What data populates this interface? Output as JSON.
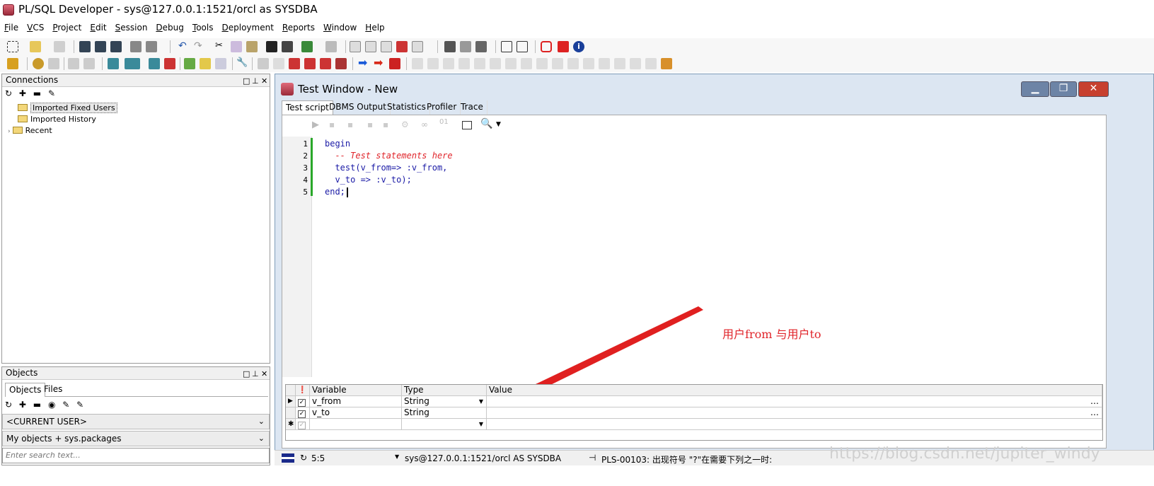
{
  "window": {
    "title": "PL/SQL Developer - sys@127.0.0.1:1521/orcl as SYSDBA"
  },
  "menu": [
    "File",
    "VCS",
    "Project",
    "Edit",
    "Session",
    "Debug",
    "Tools",
    "Deployment",
    "Reports",
    "Window",
    "Help"
  ],
  "connections": {
    "title": "Connections",
    "items": [
      "Imported Fixed Users",
      "Imported History",
      "Recent"
    ]
  },
  "objects": {
    "title": "Objects",
    "tabs": [
      "Objects",
      "Files"
    ],
    "user_select": "<CURRENT USER>",
    "filter_select": "My objects + sys.packages",
    "search_placeholder": "Enter search text..."
  },
  "test_window": {
    "title": "Test Window - New",
    "tabs": [
      "Test script",
      "DBMS Output",
      "Statistics",
      "Profiler",
      "Trace"
    ],
    "code_lines": [
      {
        "num": "1",
        "text": "begin",
        "style": "kw"
      },
      {
        "num": "2",
        "text": "  -- Test statements here",
        "style": "comment"
      },
      {
        "num": "3",
        "text": "  test(v_from=> :v_from,",
        "style": "kw"
      },
      {
        "num": "4",
        "text": "  v_to => :v_to);",
        "style": "kw"
      },
      {
        "num": "5",
        "text": "end;",
        "style": "kw"
      }
    ],
    "annotation": "用户from 与用户to",
    "grid": {
      "headers": [
        "Variable",
        "Type",
        "Value"
      ],
      "rows": [
        {
          "variable": "v_from",
          "type": "String",
          "value": ""
        },
        {
          "variable": "v_to",
          "type": "String",
          "value": ""
        }
      ]
    }
  },
  "status": {
    "position": "5:5",
    "connection": "sys@127.0.0.1:1521/orcl AS SYSDBA",
    "message": "PLS-00103: 出现符号 \"?\"在需要下列之一时:"
  },
  "watermark": "https://blog.csdn.net/jupiter_windy",
  "colors": {
    "accent_red": "#e0242a",
    "keyword_blue": "#1a1aa6",
    "panel_border": "#9a9a9a"
  }
}
